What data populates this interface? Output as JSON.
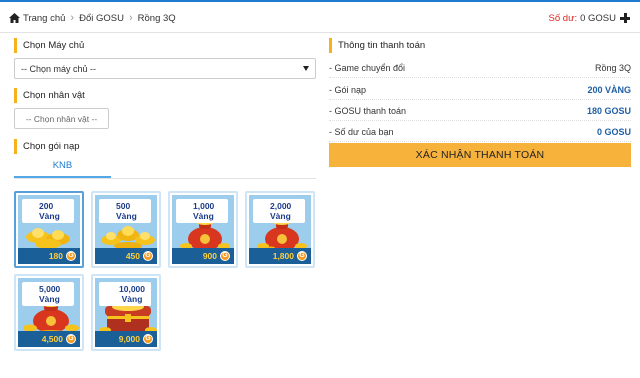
{
  "breadcrumb": {
    "home": "Trang chủ",
    "items": [
      "Đổi GOSU",
      "Rồng 3Q"
    ]
  },
  "balance": {
    "label": "Số dư:",
    "value": "0 GOSU"
  },
  "server": {
    "title": "Chọn Máy chủ",
    "value": "-- Chọn máy chủ --"
  },
  "character": {
    "title": "Chọn nhân vật",
    "value": "-- Chọn nhân vật --"
  },
  "package": {
    "title": "Chọn gói nạp",
    "tab": "KNB",
    "coin_letter": "G",
    "items": [
      {
        "label": "200 Vàng",
        "price": "180",
        "art": "ingots-small"
      },
      {
        "label": "500 Vàng",
        "price": "450",
        "art": "ingots-large"
      },
      {
        "label": "1,000 Vàng",
        "price": "900",
        "art": "bag"
      },
      {
        "label": "2,000 Vàng",
        "price": "1,800",
        "art": "bag"
      },
      {
        "label": "5,000 Vàng",
        "price": "4,500",
        "art": "bag"
      },
      {
        "label": "10,000 Vàng",
        "price": "9,000",
        "art": "chest"
      }
    ]
  },
  "payment": {
    "title": "Thông tin thanh toán",
    "rows": [
      {
        "key": "- Game chuyển đổi",
        "value": "Rồng 3Q"
      },
      {
        "key": "- Gói nạp",
        "value": "200 VÀNG"
      },
      {
        "key": "- GOSU thanh toán",
        "value": "180 GOSU"
      },
      {
        "key": "- Số dư của bạn",
        "value": "0 GOSU"
      }
    ],
    "confirm": "XÁC NHẬN THANH TOÁN"
  },
  "colors": {
    "accent": "#f7b23b",
    "brand_blue": "#1f7bd0",
    "danger": "#d9261c"
  }
}
